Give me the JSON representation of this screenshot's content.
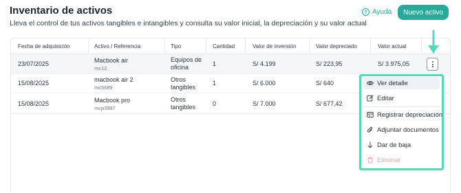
{
  "header": {
    "title": "Inventario de activos",
    "subtitle": "Lleva el control de tus activos tangibles e intangibles y consulta su valor inicial, la depreciación y su valor actual",
    "help_label": "Ayuda",
    "new_button_label": "Nuevo activo"
  },
  "table": {
    "columns": [
      "Fecha de adquisición",
      "Activo / Referencia",
      "Tipo",
      "Cantidad",
      "Valor de inversión",
      "Valor depreciado",
      "Valor actual"
    ],
    "rows": [
      {
        "fecha": "23/07/2025",
        "activo": "Macbook air",
        "referencia": "mc12",
        "tipo": "Equipos de oficina",
        "cantidad": "1",
        "inversion": "S/ 4.199",
        "depreciado": "S/ 223,95",
        "actual": "S/ 3.975,05"
      },
      {
        "fecha": "15/08/2025",
        "activo": "macbook air 2",
        "referencia": "mc5689",
        "tipo": "Otros tangibles",
        "cantidad": "1",
        "inversion": "S/ 6.000",
        "depreciado": "S/ 640",
        "actual": ""
      },
      {
        "fecha": "15/08/2025",
        "activo": "Macbook pro",
        "referencia": "mcp3987",
        "tipo": "Otros tangibles",
        "cantidad": "0",
        "inversion": "S/ 7.000",
        "depreciado": "S/ 677,42",
        "actual": ""
      }
    ]
  },
  "menu": {
    "items": [
      {
        "label": "Ver detalle",
        "icon": "eye-icon"
      },
      {
        "label": "Editar",
        "icon": "edit-icon"
      },
      {
        "label": "Registrar depreciación",
        "icon": "register-depreciation-icon"
      },
      {
        "label": "Adjuntar documentos",
        "icon": "paperclip-icon"
      },
      {
        "label": "Dar de baja",
        "icon": "arrow-down-icon"
      },
      {
        "label": "Eliminar",
        "icon": "trash-icon"
      }
    ]
  },
  "colors": {
    "accent": "#2aa89a",
    "highlight": "#57d6bc",
    "danger_disabled": "#f3a3ad"
  }
}
